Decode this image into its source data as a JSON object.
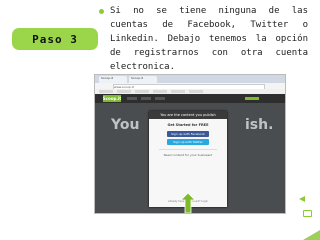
{
  "step": {
    "label": "Paso 3"
  },
  "bullet": {
    "text": "Si no se tiene ninguna de las cuentas de Facebook, Twitter o Linkedin. Debajo tenemos la opción de registrarnos con otra cuenta electronica."
  },
  "screenshot": {
    "tabs": [
      "Scoop.it",
      "Scoop.it"
    ],
    "address": "www.scoop.it",
    "logo": "Scoop.it",
    "hero_left": "You",
    "hero_right": "ish.",
    "modal": {
      "title": "You are the content you publish",
      "subtitle": "Get Started for FREE",
      "facebook_button": "Sign up with Facebook",
      "twitter_button": "Sign up with Twitter",
      "question": "Need content for your business?",
      "footer": "Already have an account? Login"
    }
  },
  "colors": {
    "accent": "#8bcc33",
    "badge": "#9bd64a",
    "facebook": "#3b5998",
    "twitter": "#29a8e0"
  }
}
